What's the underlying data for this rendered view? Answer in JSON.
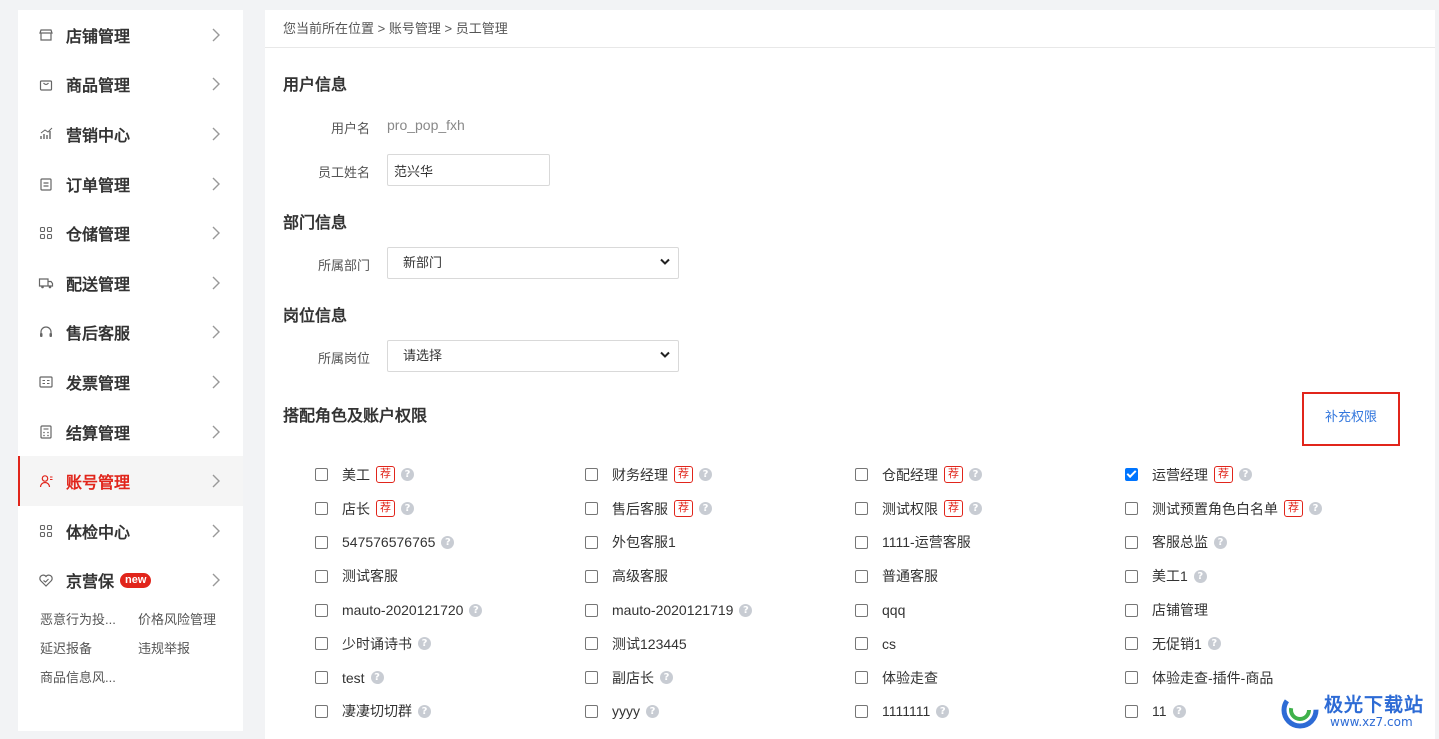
{
  "sidebar": {
    "items": [
      {
        "label": "店铺管理",
        "icon": "store-icon",
        "active": false
      },
      {
        "label": "商品管理",
        "icon": "bag-icon",
        "active": false
      },
      {
        "label": "营销中心",
        "icon": "chart-icon",
        "active": false
      },
      {
        "label": "订单管理",
        "icon": "clipboard-icon",
        "active": false
      },
      {
        "label": "仓储管理",
        "icon": "grid-icon",
        "active": false
      },
      {
        "label": "配送管理",
        "icon": "truck-icon",
        "active": false
      },
      {
        "label": "售后客服",
        "icon": "headset-icon",
        "active": false
      },
      {
        "label": "发票管理",
        "icon": "invoice-icon",
        "active": false
      },
      {
        "label": "结算管理",
        "icon": "calculator-icon",
        "active": false
      },
      {
        "label": "账号管理",
        "icon": "user-icon",
        "active": true
      },
      {
        "label": "体检中心",
        "icon": "grid-icon",
        "active": false
      },
      {
        "label": "京营保",
        "icon": "heart-shield-icon",
        "active": false,
        "badge": "new"
      }
    ],
    "sub_links": [
      "恶意行为投...",
      "价格风险管理",
      "延迟报备",
      "违规举报",
      "商品信息风..."
    ]
  },
  "breadcrumb": {
    "prefix": "您当前所在位置",
    "sep": ">",
    "level1": "账号管理",
    "level2": "员工管理"
  },
  "user_info": {
    "title": "用户信息",
    "username_label": "用户名",
    "username_value": "pro_pop_fxh",
    "employee_name_label": "员工姓名",
    "employee_name_value": "范兴华"
  },
  "dept_info": {
    "title": "部门信息",
    "dept_label": "所属部门",
    "dept_value": "新部门"
  },
  "post_info": {
    "title": "岗位信息",
    "post_label": "所属岗位",
    "post_value": "请选择"
  },
  "roles": {
    "title": "搭配角色及账户权限",
    "supplement_link": "补充权限",
    "rec_tag": "荐",
    "help_glyph": "?",
    "rows": [
      [
        {
          "label": "美工",
          "rec": true,
          "help": true,
          "checked": false
        },
        {
          "label": "财务经理",
          "rec": true,
          "help": true,
          "checked": false
        },
        {
          "label": "仓配经理",
          "rec": true,
          "help": true,
          "checked": false
        },
        {
          "label": "运营经理",
          "rec": true,
          "help": true,
          "checked": true
        }
      ],
      [
        {
          "label": "店长",
          "rec": true,
          "help": true,
          "checked": false
        },
        {
          "label": "售后客服",
          "rec": true,
          "help": true,
          "checked": false
        },
        {
          "label": "测试权限",
          "rec": true,
          "help": true,
          "checked": false
        },
        {
          "label": "测试预置角色白名单",
          "rec": true,
          "help": true,
          "checked": false
        }
      ],
      [
        {
          "label": "547576576765",
          "rec": false,
          "help": true,
          "checked": false
        },
        {
          "label": "外包客服1",
          "rec": false,
          "help": false,
          "checked": false
        },
        {
          "label": "1111-运营客服",
          "rec": false,
          "help": false,
          "checked": false
        },
        {
          "label": "客服总监",
          "rec": false,
          "help": true,
          "checked": false
        }
      ],
      [
        {
          "label": "测试客服",
          "rec": false,
          "help": false,
          "checked": false
        },
        {
          "label": "高级客服",
          "rec": false,
          "help": false,
          "checked": false
        },
        {
          "label": "普通客服",
          "rec": false,
          "help": false,
          "checked": false
        },
        {
          "label": "美工1",
          "rec": false,
          "help": true,
          "checked": false
        }
      ],
      [
        {
          "label": "mauto-2020121720",
          "rec": false,
          "help": true,
          "checked": false
        },
        {
          "label": "mauto-2020121719",
          "rec": false,
          "help": true,
          "checked": false
        },
        {
          "label": "qqq",
          "rec": false,
          "help": false,
          "checked": false
        },
        {
          "label": "店铺管理",
          "rec": false,
          "help": false,
          "checked": false
        }
      ],
      [
        {
          "label": "少时诵诗书",
          "rec": false,
          "help": true,
          "checked": false
        },
        {
          "label": "测试123445",
          "rec": false,
          "help": false,
          "checked": false
        },
        {
          "label": "cs",
          "rec": false,
          "help": false,
          "checked": false
        },
        {
          "label": "无促销1",
          "rec": false,
          "help": true,
          "checked": false
        }
      ],
      [
        {
          "label": "test",
          "rec": false,
          "help": true,
          "checked": false
        },
        {
          "label": "副店长",
          "rec": false,
          "help": true,
          "checked": false
        },
        {
          "label": "体验走查",
          "rec": false,
          "help": false,
          "checked": false
        },
        {
          "label": "体验走查-插件-商品",
          "rec": false,
          "help": false,
          "checked": false
        }
      ],
      [
        {
          "label": "凄凄切切群",
          "rec": false,
          "help": true,
          "checked": false
        },
        {
          "label": "yyyy",
          "rec": false,
          "help": true,
          "checked": false
        },
        {
          "label": "1111111",
          "rec": false,
          "help": true,
          "checked": false
        },
        {
          "label": "11",
          "rec": false,
          "help": true,
          "checked": false
        }
      ]
    ]
  },
  "watermark": {
    "text": "极光下载站",
    "url": "www.xz7.com"
  },
  "colors": {
    "accent": "#e1251b",
    "link": "#3377dd",
    "checkbox": "#0075ff"
  }
}
